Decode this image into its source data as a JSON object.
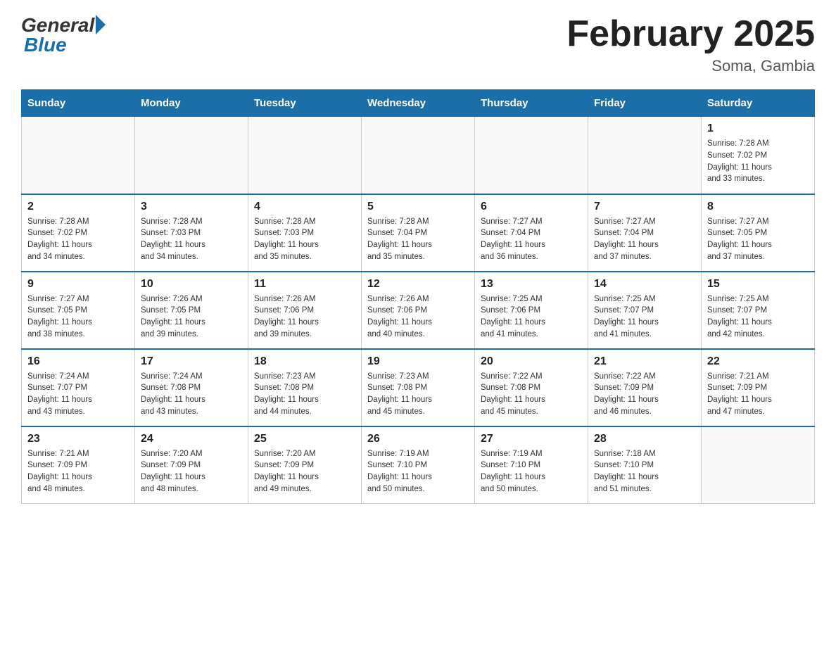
{
  "logo": {
    "general": "General",
    "blue": "Blue"
  },
  "title": {
    "month_year": "February 2025",
    "location": "Soma, Gambia"
  },
  "days_of_week": [
    "Sunday",
    "Monday",
    "Tuesday",
    "Wednesday",
    "Thursday",
    "Friday",
    "Saturday"
  ],
  "weeks": [
    [
      {
        "day": "",
        "info": ""
      },
      {
        "day": "",
        "info": ""
      },
      {
        "day": "",
        "info": ""
      },
      {
        "day": "",
        "info": ""
      },
      {
        "day": "",
        "info": ""
      },
      {
        "day": "",
        "info": ""
      },
      {
        "day": "1",
        "info": "Sunrise: 7:28 AM\nSunset: 7:02 PM\nDaylight: 11 hours\nand 33 minutes."
      }
    ],
    [
      {
        "day": "2",
        "info": "Sunrise: 7:28 AM\nSunset: 7:02 PM\nDaylight: 11 hours\nand 34 minutes."
      },
      {
        "day": "3",
        "info": "Sunrise: 7:28 AM\nSunset: 7:03 PM\nDaylight: 11 hours\nand 34 minutes."
      },
      {
        "day": "4",
        "info": "Sunrise: 7:28 AM\nSunset: 7:03 PM\nDaylight: 11 hours\nand 35 minutes."
      },
      {
        "day": "5",
        "info": "Sunrise: 7:28 AM\nSunset: 7:04 PM\nDaylight: 11 hours\nand 35 minutes."
      },
      {
        "day": "6",
        "info": "Sunrise: 7:27 AM\nSunset: 7:04 PM\nDaylight: 11 hours\nand 36 minutes."
      },
      {
        "day": "7",
        "info": "Sunrise: 7:27 AM\nSunset: 7:04 PM\nDaylight: 11 hours\nand 37 minutes."
      },
      {
        "day": "8",
        "info": "Sunrise: 7:27 AM\nSunset: 7:05 PM\nDaylight: 11 hours\nand 37 minutes."
      }
    ],
    [
      {
        "day": "9",
        "info": "Sunrise: 7:27 AM\nSunset: 7:05 PM\nDaylight: 11 hours\nand 38 minutes."
      },
      {
        "day": "10",
        "info": "Sunrise: 7:26 AM\nSunset: 7:05 PM\nDaylight: 11 hours\nand 39 minutes."
      },
      {
        "day": "11",
        "info": "Sunrise: 7:26 AM\nSunset: 7:06 PM\nDaylight: 11 hours\nand 39 minutes."
      },
      {
        "day": "12",
        "info": "Sunrise: 7:26 AM\nSunset: 7:06 PM\nDaylight: 11 hours\nand 40 minutes."
      },
      {
        "day": "13",
        "info": "Sunrise: 7:25 AM\nSunset: 7:06 PM\nDaylight: 11 hours\nand 41 minutes."
      },
      {
        "day": "14",
        "info": "Sunrise: 7:25 AM\nSunset: 7:07 PM\nDaylight: 11 hours\nand 41 minutes."
      },
      {
        "day": "15",
        "info": "Sunrise: 7:25 AM\nSunset: 7:07 PM\nDaylight: 11 hours\nand 42 minutes."
      }
    ],
    [
      {
        "day": "16",
        "info": "Sunrise: 7:24 AM\nSunset: 7:07 PM\nDaylight: 11 hours\nand 43 minutes."
      },
      {
        "day": "17",
        "info": "Sunrise: 7:24 AM\nSunset: 7:08 PM\nDaylight: 11 hours\nand 43 minutes."
      },
      {
        "day": "18",
        "info": "Sunrise: 7:23 AM\nSunset: 7:08 PM\nDaylight: 11 hours\nand 44 minutes."
      },
      {
        "day": "19",
        "info": "Sunrise: 7:23 AM\nSunset: 7:08 PM\nDaylight: 11 hours\nand 45 minutes."
      },
      {
        "day": "20",
        "info": "Sunrise: 7:22 AM\nSunset: 7:08 PM\nDaylight: 11 hours\nand 45 minutes."
      },
      {
        "day": "21",
        "info": "Sunrise: 7:22 AM\nSunset: 7:09 PM\nDaylight: 11 hours\nand 46 minutes."
      },
      {
        "day": "22",
        "info": "Sunrise: 7:21 AM\nSunset: 7:09 PM\nDaylight: 11 hours\nand 47 minutes."
      }
    ],
    [
      {
        "day": "23",
        "info": "Sunrise: 7:21 AM\nSunset: 7:09 PM\nDaylight: 11 hours\nand 48 minutes."
      },
      {
        "day": "24",
        "info": "Sunrise: 7:20 AM\nSunset: 7:09 PM\nDaylight: 11 hours\nand 48 minutes."
      },
      {
        "day": "25",
        "info": "Sunrise: 7:20 AM\nSunset: 7:09 PM\nDaylight: 11 hours\nand 49 minutes."
      },
      {
        "day": "26",
        "info": "Sunrise: 7:19 AM\nSunset: 7:10 PM\nDaylight: 11 hours\nand 50 minutes."
      },
      {
        "day": "27",
        "info": "Sunrise: 7:19 AM\nSunset: 7:10 PM\nDaylight: 11 hours\nand 50 minutes."
      },
      {
        "day": "28",
        "info": "Sunrise: 7:18 AM\nSunset: 7:10 PM\nDaylight: 11 hours\nand 51 minutes."
      },
      {
        "day": "",
        "info": ""
      }
    ]
  ]
}
